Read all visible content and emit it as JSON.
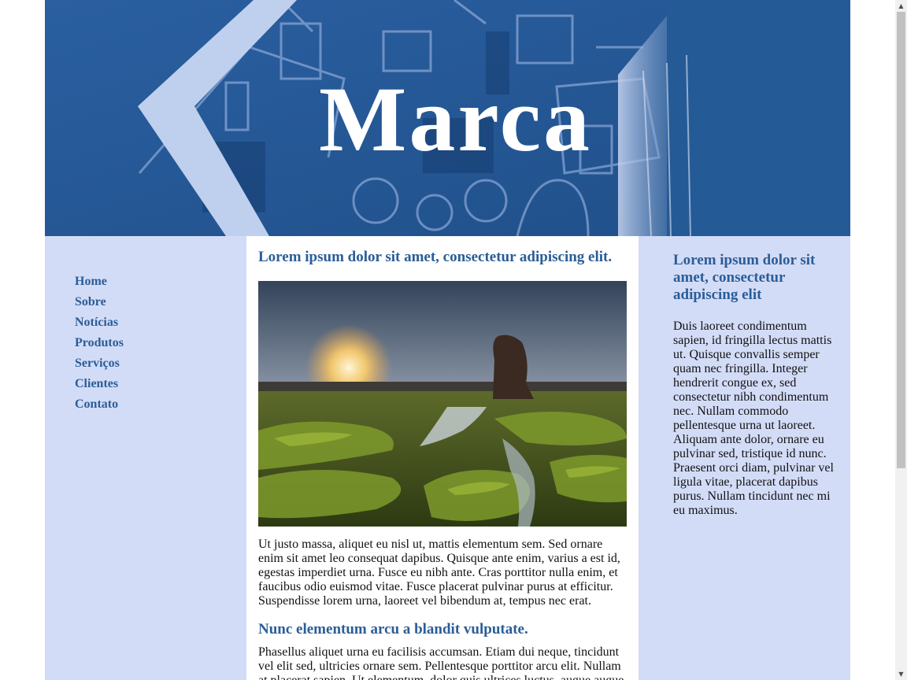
{
  "header": {
    "brand": "Marca"
  },
  "nav": {
    "items": [
      "Home",
      "Sobre",
      "Notícias",
      "Produtos",
      "Serviços",
      "Clientes",
      "Contato"
    ]
  },
  "main": {
    "title": "Lorem ipsum dolor sit amet, consectetur adipiscing elit.",
    "paragraph1": "Ut justo massa, aliquet eu nisl ut, mattis elementum sem. Sed ornare enim sit amet leo consequat dapibus. Quisque ante enim, varius a est id, egestas imperdiet urna. Fusce eu nibh ante. Cras porttitor nulla enim, et faucibus odio euismod vitae. Fusce placerat pulvinar purus at efficitur. Suspendisse lorem urna, laoreet vel bibendum at, tempus nec erat.",
    "subtitle": "Nunc elementum arcu a blandit vulputate.",
    "paragraph2": "Phasellus aliquet urna eu facilisis accumsan. Etiam dui neque, tincidunt vel elit sed, ultricies ornare sem. Pellentesque porttitor arcu elit. Nullam at placerat sapien. Ut elementum, dolor quis ultrices luctus, augue augue"
  },
  "sidebar": {
    "title": "Lorem ipsum dolor sit amet, consectetur adipiscing elit",
    "paragraph": "Duis laoreet condimentum sapien, id fringilla lectus mattis ut. Quisque convallis semper quam nec fringilla. Integer hendrerit congue ex, sed consectetur nibh condimentum nec. Nullam commodo pellentesque urna ut laoreet. Aliquam ante dolor, ornare eu pulvinar sed, tristique id nunc. Praesent orci diam, pulvinar vel ligula vitae, placerat dapibus purus. Nullam tincidunt nec mi eu maximus."
  },
  "colors": {
    "banner": "#245a96",
    "side_columns": "#d3dcf7",
    "link": "#2b5d97",
    "heading": "#2b5d97"
  }
}
